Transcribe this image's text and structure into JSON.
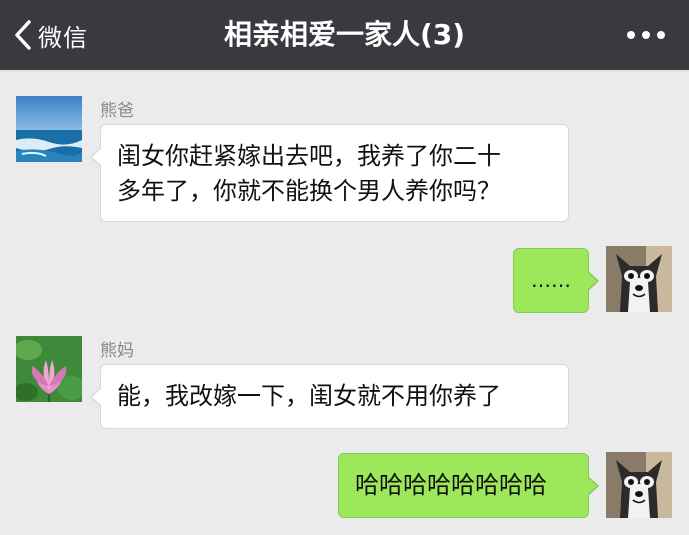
{
  "header": {
    "back_label": "微信",
    "title": "相亲相爱一家人(3)",
    "back_icon": "chevron-left-icon",
    "more_icon": "more-dots-icon",
    "background_color": "#393a3f"
  },
  "messages": [
    {
      "side": "left",
      "sender": "熊爸",
      "avatar": "ocean-beach-avatar",
      "lines": [
        "闺女你赶紧嫁出去吧，我养了你二十",
        "多年了，你就不能换个男人养你吗？"
      ]
    },
    {
      "side": "right",
      "avatar": "husky-dog-avatar",
      "text": "……"
    },
    {
      "side": "left",
      "sender": "熊妈",
      "avatar": "lotus-flower-avatar",
      "text": "能，我改嫁一下，闺女就不用你养了"
    },
    {
      "side": "right",
      "avatar": "husky-dog-avatar",
      "text": "哈哈哈哈哈哈哈哈"
    }
  ],
  "colors": {
    "chat_background": "#ebebeb",
    "own_bubble": "#9de85a",
    "other_bubble": "#ffffff"
  }
}
